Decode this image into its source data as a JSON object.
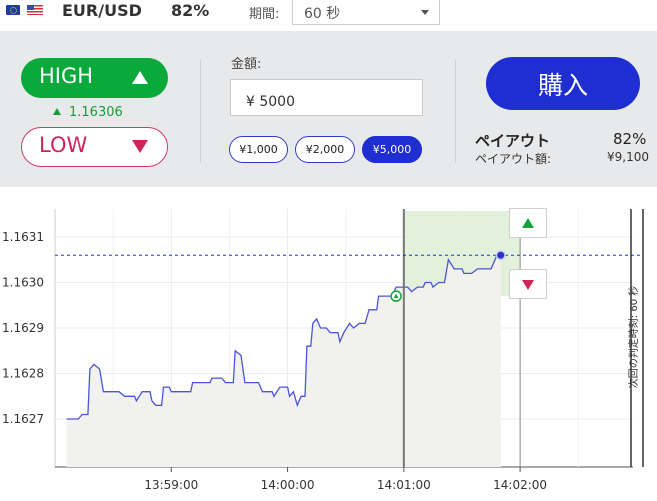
{
  "header": {
    "flags": [
      "eu-flag-icon",
      "us-flag-icon"
    ],
    "pair": "EUR/USD",
    "payout_percent": "82%",
    "period_label": "期間:",
    "period_value": "60 秒"
  },
  "trade": {
    "high_label": "HIGH",
    "high_rate": "1.16306",
    "low_label": "LOW",
    "amount_label": "金額:",
    "amount_value": "¥ 5000",
    "presets": [
      {
        "label": "¥1,000",
        "selected": false
      },
      {
        "label": "¥2,000",
        "selected": false
      },
      {
        "label": "¥5,000",
        "selected": true
      }
    ],
    "buy_label": "購入",
    "payout_title": "ペイアウト",
    "payout_percent": "82%",
    "payout_amount_label": "ペイアウト額:",
    "payout_amount": "¥9,100"
  },
  "colors": {
    "high": "#09a93c",
    "low": "#d0245a",
    "accent": "#1f2ed1",
    "line": "#4b55d6",
    "panel": "#e8e9ea",
    "zone": "#e3f1dc"
  },
  "chart_data": {
    "type": "line",
    "y_ticks": [
      "1.1631",
      "1.1630",
      "1.1629",
      "1.1628",
      "1.1627"
    ],
    "x_ticks": [
      "13:59:00",
      "14:00:00",
      "14:01:00",
      "14:02:00"
    ],
    "current_rate": 1.16306,
    "entry_rate": 1.16297,
    "next_judgement_label": "次回の判定時刻: 60 秒",
    "series": [
      {
        "values": [
          [
            "13:58:06",
            1.1627
          ],
          [
            "13:58:12",
            1.1627
          ],
          [
            "13:58:14",
            1.16271
          ],
          [
            "13:58:17",
            1.16271
          ],
          [
            "13:58:18",
            1.16281
          ],
          [
            "13:58:20",
            1.16282
          ],
          [
            "13:58:23",
            1.16281
          ],
          [
            "13:58:25",
            1.16276
          ],
          [
            "13:58:33",
            1.16276
          ],
          [
            "13:58:36",
            1.16275
          ],
          [
            "13:58:41",
            1.16275
          ],
          [
            "13:58:42",
            1.16274
          ],
          [
            "13:58:45",
            1.16276
          ],
          [
            "13:58:49",
            1.16276
          ],
          [
            "13:58:50",
            1.16274
          ],
          [
            "13:58:52",
            1.16273
          ],
          [
            "13:58:55",
            1.16273
          ],
          [
            "13:58:56",
            1.16277
          ],
          [
            "13:58:59",
            1.16277
          ],
          [
            "13:59:00",
            1.16276
          ],
          [
            "13:59:10",
            1.16276
          ],
          [
            "13:59:11",
            1.16278
          ],
          [
            "13:59:20",
            1.16278
          ],
          [
            "13:59:21",
            1.16279
          ],
          [
            "13:59:26",
            1.16279
          ],
          [
            "13:59:28",
            1.16278
          ],
          [
            "13:59:32",
            1.16278
          ],
          [
            "13:59:33",
            1.16285
          ],
          [
            "13:59:36",
            1.16284
          ],
          [
            "13:59:38",
            1.16278
          ],
          [
            "13:59:45",
            1.16278
          ],
          [
            "13:59:47",
            1.16276
          ],
          [
            "13:59:52",
            1.16276
          ],
          [
            "13:59:53",
            1.16275
          ],
          [
            "13:59:56",
            1.16277
          ],
          [
            "14:00:00",
            1.16277
          ],
          [
            "14:00:01",
            1.16275
          ],
          [
            "14:00:03",
            1.16276
          ],
          [
            "14:00:05",
            1.16273
          ],
          [
            "14:00:07",
            1.16275
          ],
          [
            "14:00:09",
            1.16275
          ],
          [
            "14:00:10",
            1.16286
          ],
          [
            "14:00:12",
            1.16286
          ],
          [
            "14:00:13",
            1.16291
          ],
          [
            "14:00:15",
            1.16292
          ],
          [
            "14:00:17",
            1.1629
          ],
          [
            "14:00:20",
            1.1629
          ],
          [
            "14:00:22",
            1.16289
          ],
          [
            "14:00:26",
            1.16289
          ],
          [
            "14:00:27",
            1.16287
          ],
          [
            "14:00:29",
            1.16289
          ],
          [
            "14:00:32",
            1.16291
          ],
          [
            "14:00:34",
            1.1629
          ],
          [
            "14:00:37",
            1.16291
          ],
          [
            "14:00:40",
            1.16291
          ],
          [
            "14:00:42",
            1.16294
          ],
          [
            "14:00:46",
            1.16294
          ],
          [
            "14:00:47",
            1.16297
          ],
          [
            "14:00:50",
            1.16297
          ],
          [
            "14:00:54",
            1.16297
          ],
          [
            "14:00:56",
            1.16299
          ],
          [
            "14:01:00",
            1.16299
          ],
          [
            "14:01:02",
            1.16299
          ],
          [
            "14:01:04",
            1.16298
          ],
          [
            "14:01:07",
            1.16299
          ],
          [
            "14:01:10",
            1.16299
          ],
          [
            "14:01:11",
            1.163
          ],
          [
            "14:01:14",
            1.163
          ],
          [
            "14:01:15",
            1.16299
          ],
          [
            "14:01:18",
            1.163
          ],
          [
            "14:01:21",
            1.163
          ],
          [
            "14:01:23",
            1.16305
          ],
          [
            "14:01:26",
            1.16303
          ],
          [
            "14:01:30",
            1.16303
          ],
          [
            "14:01:31",
            1.16302
          ],
          [
            "14:01:35",
            1.16302
          ],
          [
            "14:01:38",
            1.16303
          ],
          [
            "14:01:41",
            1.16303
          ],
          [
            "14:01:45",
            1.16303
          ],
          [
            "14:01:48",
            1.16306
          ],
          [
            "14:01:50",
            1.16306
          ]
        ]
      }
    ]
  }
}
